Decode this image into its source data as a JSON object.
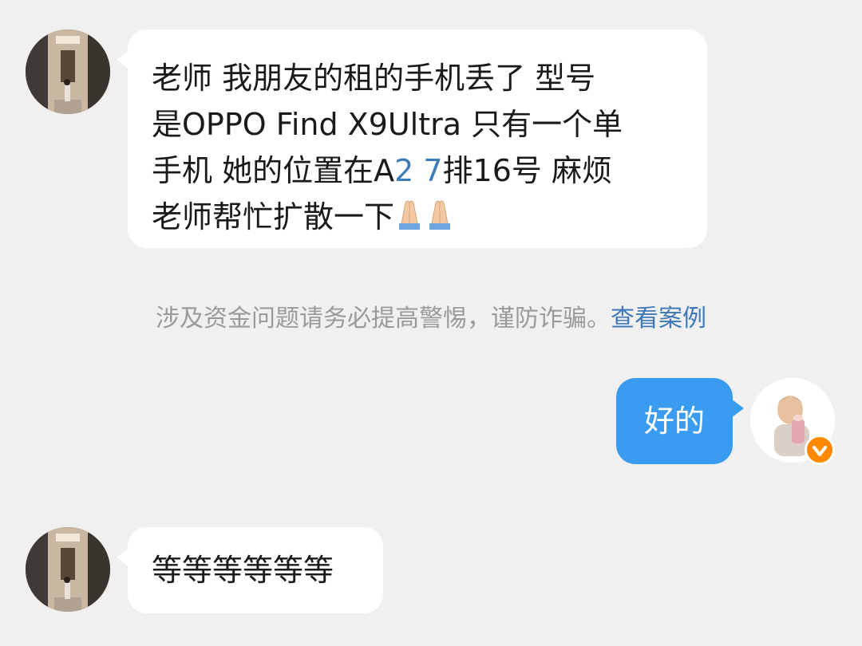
{
  "messages": [
    {
      "sender": "other",
      "lines": [
        "老师 我朋友的租的手机丢了 型号",
        "是OPPO Find X9Ultra 只有一个单",
        "手机 她的位置在A",
        "老师帮忙扩散一下"
      ],
      "line3_parts": [
        "手机 她的位置在A",
        "2 7",
        "排16号 麻烦"
      ],
      "emoji": "folded-hands-icon"
    },
    {
      "sender": "me",
      "text": "好的"
    },
    {
      "sender": "other",
      "text": "等等等等等等"
    }
  ],
  "notice": {
    "text": "涉及资金问题请务必提高警惕，谨防诈骗。",
    "link": "查看案例"
  },
  "colors": {
    "background": "#f0f0f0",
    "bubble_other": "#ffffff",
    "bubble_me": "#3a9cf0",
    "link": "#3e78b8",
    "verified_badge": "#ff8a00"
  }
}
